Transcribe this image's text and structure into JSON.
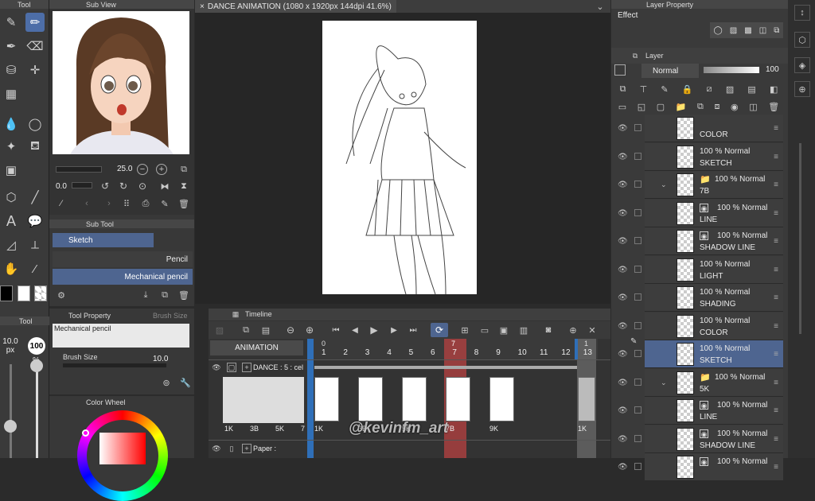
{
  "tool_panel": {
    "title": "Tool",
    "brush_size_value": "10.0",
    "brush_size_unit": "px",
    "opacity_value": "100",
    "opacity_unit": "%"
  },
  "sub_view": {
    "title": "Sub View",
    "zoom_value": "25.0",
    "rotation_value": "0.0"
  },
  "sub_tool": {
    "title": "Sub Tool",
    "group": "Sketch",
    "items": [
      "Pencil",
      "Mechanical pencil"
    ]
  },
  "tool_property": {
    "title": "Tool Property",
    "tab2": "Brush Size",
    "tool_name": "Mechanical pencil",
    "brush_size_label": "Brush Size",
    "brush_size_value": "10.0"
  },
  "color_wheel": {
    "title": "Color Wheel"
  },
  "document": {
    "tab": "DANCE ANIMATION (1080 x 1920px 144dpi 41.6%)"
  },
  "timeline": {
    "title": "Timeline",
    "name": "ANIMATION",
    "frame_numbers": [
      "1",
      "2",
      "3",
      "4",
      "5",
      "6",
      "7",
      "8",
      "9",
      "10",
      "11",
      "12",
      "13"
    ],
    "marker_top": "0",
    "current_frame": "7",
    "current_frame_label": "7",
    "track1_label": "DANCE : 5 : cel",
    "track2_label": "Paper :",
    "cels_left": [
      "1K",
      "3B",
      "5K",
      "7"
    ],
    "cels_right": [
      "1K",
      "3B",
      "5K",
      "7B",
      "9K"
    ],
    "cel_far_right": "1K",
    "end_marker": "1"
  },
  "layer_property": {
    "title": "Layer Property",
    "effect_label": "Effect"
  },
  "layer_panel": {
    "title": "Layer",
    "blend_mode": "Normal",
    "opacity": "100",
    "rows": [
      {
        "mode": "",
        "name": "COLOR"
      },
      {
        "mode": "100 % Normal",
        "name": "SKETCH"
      },
      {
        "mode": "100 % Normal",
        "name": "7B"
      },
      {
        "mode": "100 % Normal",
        "name": "LINE"
      },
      {
        "mode": "100 % Normal",
        "name": "SHADOW LINE"
      },
      {
        "mode": "100 % Normal",
        "name": "LIGHT"
      },
      {
        "mode": "100 % Normal",
        "name": "SHADING"
      },
      {
        "mode": "100 % Normal",
        "name": "COLOR"
      },
      {
        "mode": "100 % Normal",
        "name": "SKETCH"
      },
      {
        "mode": "100 % Normal",
        "name": "5K"
      },
      {
        "mode": "100 % Normal",
        "name": "LINE"
      },
      {
        "mode": "100 % Normal",
        "name": "SHADOW LINE"
      },
      {
        "mode": "100 % Normal",
        "name": ""
      }
    ]
  },
  "watermark": "@kevinfm_art",
  "colors": {
    "accent": "#4d6ea8",
    "current_frame": "#b84141",
    "selection": "#4e6590"
  }
}
